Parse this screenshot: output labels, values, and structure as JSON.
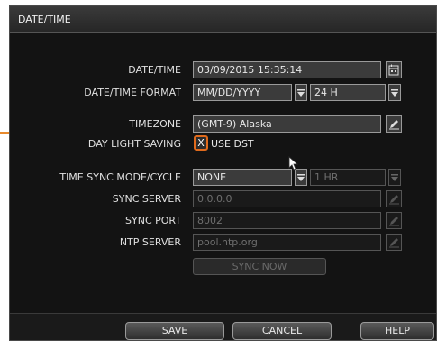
{
  "window": {
    "title": "DATE/TIME"
  },
  "fields": {
    "datetime": {
      "label": "DATE/TIME",
      "value": "03/09/2015 15:35:14"
    },
    "format": {
      "label": "DATE/TIME FORMAT",
      "date_value": "MM/DD/YYYY",
      "time_value": "24 H"
    },
    "timezone": {
      "label": "TIMEZONE",
      "value": "(GMT-9) Alaska"
    },
    "dst": {
      "label": "DAY LIGHT SAVING",
      "checkbox_mark": "X",
      "checkbox_label": "USE DST"
    },
    "sync_mode": {
      "label": "TIME SYNC MODE/CYCLE",
      "value": "NONE",
      "cycle_value": "1 HR"
    },
    "sync_server": {
      "label": "SYNC SERVER",
      "value": "0.0.0.0"
    },
    "sync_port": {
      "label": "SYNC PORT",
      "value": "8002"
    },
    "ntp_server": {
      "label": "NTP SERVER",
      "value": "pool.ntp.org"
    },
    "sync_now": {
      "label": "SYNC NOW"
    }
  },
  "buttons": {
    "save": "SAVE",
    "cancel": "CANCEL",
    "help": "HELP"
  },
  "icons": {
    "calendar": "calendar-icon",
    "edit": "pencil-edit-icon",
    "dropdown": "triangle-down-icon"
  },
  "colors": {
    "highlight": "#e06a1c",
    "background": "#131313",
    "field": "#3b3b3b"
  }
}
